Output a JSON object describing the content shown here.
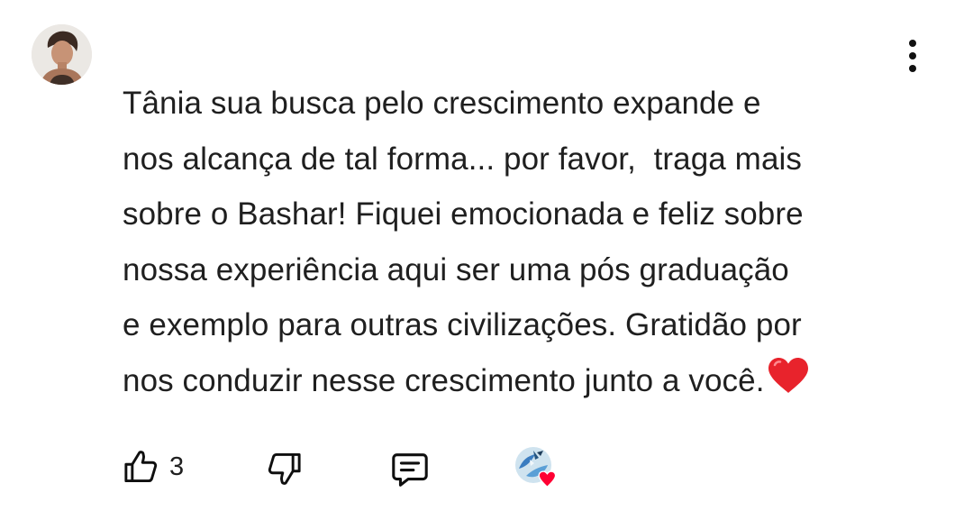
{
  "comment": {
    "author_avatar": "avatar",
    "text_lines": [
      "Tânia sua busca pelo crescimento expande e",
      "nos alcança de tal forma... por favor,  traga mais",
      "sobre o Bashar! Fiquei emocionada e feliz sobre",
      "nossa experiência aqui ser uma pós graduação",
      "e exemplo para outras civilizações. Gratidão por",
      "nos conduzir nesse crescimento junto a você."
    ],
    "end_emoji": "red-heart-emoji"
  },
  "menu": {
    "icon": "more-vertical-icon"
  },
  "actions": {
    "like_icon": "thumbs-up-icon",
    "like_count": "3",
    "dislike_icon": "thumbs-down-icon",
    "reply_icon": "reply-comment-icon",
    "creator_heart": "creator-heart-badge"
  },
  "colors": {
    "text": "#1f1f1f",
    "icon": "#0f0f0f",
    "heart": "#ff0033"
  }
}
